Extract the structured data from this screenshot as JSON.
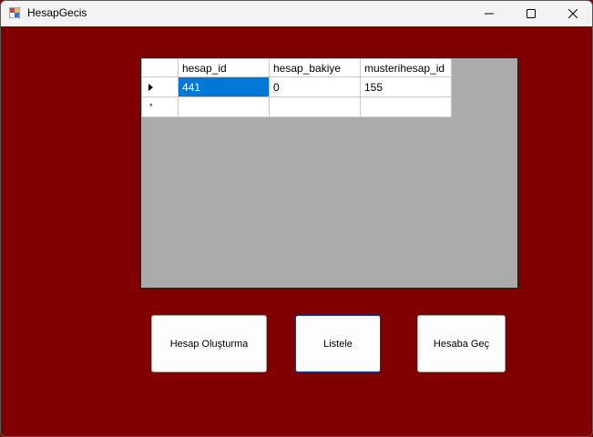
{
  "window": {
    "title": "HesapGecis",
    "icon": "app-window-icon"
  },
  "grid": {
    "columns": [
      "hesap_id",
      "hesap_bakiye",
      "musterihesap_id"
    ],
    "rows": [
      {
        "hesap_id": "441",
        "hesap_bakiye": "0",
        "musterihesap_id": "155"
      }
    ],
    "new_row_marker": "*"
  },
  "buttons": {
    "create": "Hesap Oluşturma",
    "list": "Listele",
    "switch": "Hesaba Geç"
  },
  "colors": {
    "background": "#800000",
    "selection": "#0078d7",
    "grid_bg": "#ababab"
  }
}
